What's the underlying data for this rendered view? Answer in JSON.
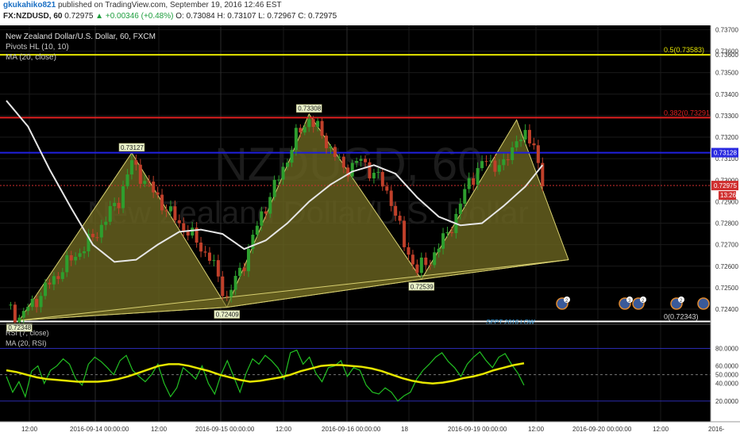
{
  "header": {
    "author": "gkukahiko821",
    "published": "published on TradingView.com, September 19, 2016 12:46 EST",
    "symbol": "FX:NZDUSD, 60",
    "last": "0.72975",
    "change": "▲ +0.00346 (+0.48%)",
    "ohlc": "O: 0.73084 H: 0.73107 L: 0.72967 C: 0.72975"
  },
  "legend": {
    "title": "New Zealand Dollar/U.S. Dollar, 60, FXCM",
    "ind1": "Pivots HL (10, 10)",
    "ind2": "MA (20, close)",
    "rsi": "RSI (7, close)",
    "rsi_ma": "MA (20, RSI)"
  },
  "watermark": {
    "symbol": "NZDUSD, 60",
    "name": "New Zealand Dollar/U.S. Dollar"
  },
  "colors": {
    "background": "#000000",
    "bull": "#2e9e2e",
    "bear": "#c0402a",
    "ma": "#e6e6e6",
    "triangle_fill": "#6b6520",
    "triangle_stroke": "#d8d070",
    "fib_50": "#e6e600",
    "fib_382": "#e02020",
    "support": "#2020e0",
    "rsi_line": "#22c022",
    "rsi_ma": "#e6e600",
    "sept_low": "#ffffff"
  },
  "chart_data": [
    {
      "type": "candlestick",
      "title": "New Zealand Dollar/U.S. Dollar, 60, FXCM",
      "ylim": [
        0.7233,
        0.7372
      ],
      "y_ticks": [
        "0.73700",
        "0.73600",
        "0.73500",
        "0.73400",
        "0.73300",
        "0.73200",
        "0.73100",
        "0.73000",
        "0.72900",
        "0.72800",
        "0.72700",
        "0.72600",
        "0.72500",
        "0.72400"
      ],
      "x_ticks": [
        "12:00",
        "2016-09-14 00:00:00",
        "12:00",
        "2016-09-15 00:00:00",
        "12:00",
        "2016-09-16 00:00:00",
        "18",
        "2016-09-19 00:00:00",
        "12:00",
        "2016-09-20 00:00:00",
        "12:00",
        "2016-"
      ],
      "close_path": [
        [
          0,
          0.7242
        ],
        [
          3,
          0.7236
        ],
        [
          8,
          0.7247
        ],
        [
          13,
          0.7259
        ],
        [
          20,
          0.7273
        ],
        [
          26,
          0.7291
        ],
        [
          29,
          0.7308
        ],
        [
          33,
          0.7297
        ],
        [
          38,
          0.7284
        ],
        [
          42,
          0.7276
        ],
        [
          47,
          0.7264
        ],
        [
          51,
          0.7245
        ],
        [
          55,
          0.7262
        ],
        [
          59,
          0.7284
        ],
        [
          63,
          0.7301
        ],
        [
          67,
          0.732
        ],
        [
          70,
          0.7329
        ],
        [
          74,
          0.7318
        ],
        [
          78,
          0.7305
        ],
        [
          82,
          0.7309
        ],
        [
          86,
          0.7301
        ],
        [
          89,
          0.7291
        ],
        [
          92,
          0.727
        ],
        [
          95,
          0.7258
        ],
        [
          98,
          0.7263
        ],
        [
          101,
          0.7272
        ],
        [
          104,
          0.7283
        ],
        [
          107,
          0.73
        ],
        [
          111,
          0.7309
        ],
        [
          115,
          0.7306
        ],
        [
          118,
          0.732
        ],
        [
          122,
          0.7318
        ],
        [
          124,
          0.7298
        ]
      ],
      "ma_path": [
        [
          0,
          0.7337
        ],
        [
          5,
          0.7325
        ],
        [
          10,
          0.7305
        ],
        [
          15,
          0.7287
        ],
        [
          20,
          0.727
        ],
        [
          25,
          0.7262
        ],
        [
          30,
          0.7263
        ],
        [
          35,
          0.727
        ],
        [
          40,
          0.7276
        ],
        [
          45,
          0.7277
        ],
        [
          50,
          0.7275
        ],
        [
          55,
          0.7268
        ],
        [
          60,
          0.7272
        ],
        [
          65,
          0.728
        ],
        [
          70,
          0.729
        ],
        [
          75,
          0.7298
        ],
        [
          80,
          0.7304
        ],
        [
          85,
          0.7307
        ],
        [
          90,
          0.7303
        ],
        [
          95,
          0.7292
        ],
        [
          100,
          0.7283
        ],
        [
          105,
          0.7279
        ],
        [
          110,
          0.728
        ],
        [
          115,
          0.7288
        ],
        [
          120,
          0.7297
        ],
        [
          124,
          0.7307
        ]
      ],
      "pivots": [
        {
          "label": "0.72348",
          "price": 0.72348,
          "bar": 3,
          "pos": "low"
        },
        {
          "label": "0.73127",
          "price": 0.73127,
          "bar": 29,
          "pos": "high"
        },
        {
          "label": "0.72409",
          "price": 0.72409,
          "bar": 51,
          "pos": "low"
        },
        {
          "label": "0.73308",
          "price": 0.73308,
          "bar": 70,
          "pos": "high"
        },
        {
          "label": "0.72539",
          "price": 0.72539,
          "bar": 96,
          "pos": "low"
        }
      ],
      "right_high": {
        "price": 0.7328,
        "bar": 118
      },
      "apex": {
        "price": 0.7263,
        "bar": 130
      },
      "levels": [
        {
          "name": "fib-50",
          "label": "0.5(0.73583)",
          "price": 0.73583
        },
        {
          "name": "fib-382",
          "label": "0.382(0.73291)",
          "price": 0.73291
        },
        {
          "name": "support",
          "label": "",
          "price": 0.73128
        },
        {
          "name": "sept-low",
          "label": "0(0.72343)",
          "price": 0.72343
        }
      ],
      "annotation": "SEPT 2016 LOW",
      "price_tags": {
        "support": "0.73128",
        "last": "0.72975",
        "countdown": "13:26"
      },
      "event_badges": [
        "2",
        "3",
        "2",
        "2"
      ]
    },
    {
      "type": "line",
      "title": "RSI (7, close)",
      "ylim": [
        0,
        100
      ],
      "y_ticks": [
        "80.0000",
        "60.0000",
        "50.0000",
        "40.0000",
        "20.0000"
      ],
      "rsi_ma_label": "MA (20, RSI)",
      "rsi_values": [
        48,
        30,
        42,
        25,
        54,
        60,
        40,
        55,
        60,
        68,
        62,
        45,
        38,
        62,
        70,
        65,
        58,
        50,
        66,
        72,
        55,
        48,
        42,
        50,
        62,
        40,
        25,
        35,
        58,
        52,
        45,
        60,
        40,
        28,
        50,
        66,
        48,
        30,
        52,
        68,
        62,
        72,
        66,
        58,
        45,
        75,
        78,
        62,
        70,
        52,
        42,
        58,
        60,
        66,
        48,
        58,
        55,
        38,
        30,
        28,
        35,
        30,
        20,
        26,
        30,
        45,
        55,
        62,
        70,
        75,
        65,
        58,
        48,
        62,
        70,
        76,
        66,
        58,
        70,
        74,
        62,
        52,
        38
      ],
      "rsi_ma_values": [
        55,
        53,
        50,
        47,
        45,
        44,
        43,
        42,
        42,
        42,
        43,
        45,
        48,
        52,
        56,
        60,
        62,
        62,
        60,
        57,
        54,
        50,
        47,
        44,
        42,
        43,
        45,
        47,
        50,
        54,
        57,
        60,
        61,
        61,
        60,
        59,
        57,
        54,
        50,
        46,
        43,
        41,
        40,
        41,
        43,
        46,
        48,
        51,
        55,
        58,
        61,
        63
      ]
    }
  ]
}
